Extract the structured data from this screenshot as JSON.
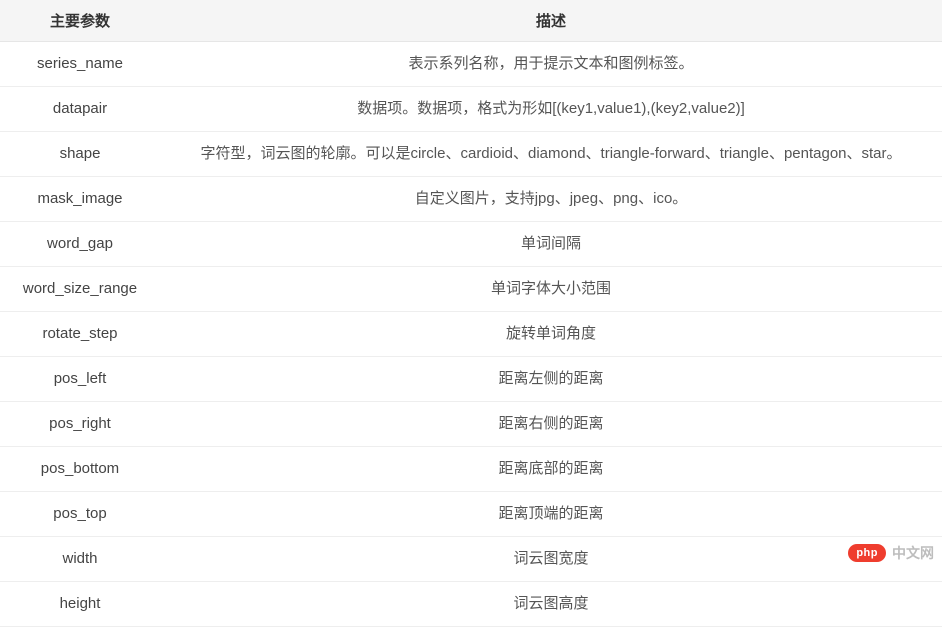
{
  "table": {
    "headers": {
      "param": "主要参数",
      "desc": "描述"
    },
    "rows": [
      {
        "param": "series_name",
        "desc": "表示系列名称，用于提示文本和图例标签。"
      },
      {
        "param": "datapair",
        "desc": "数据项。数据项，格式为形如[(key1,value1),(key2,value2)]"
      },
      {
        "param": "shape",
        "desc": "字符型，词云图的轮廓。可以是circle、cardioid、diamond、triangle-forward、triangle、pentagon、star。"
      },
      {
        "param": "mask_image",
        "desc": "自定义图片，支持jpg、jpeg、png、ico。"
      },
      {
        "param": "word_gap",
        "desc": "单词间隔"
      },
      {
        "param": "word_size_range",
        "desc": "单词字体大小范围"
      },
      {
        "param": "rotate_step",
        "desc": "旋转单词角度"
      },
      {
        "param": "pos_left",
        "desc": "距离左侧的距离"
      },
      {
        "param": "pos_right",
        "desc": "距离右侧的距离"
      },
      {
        "param": "pos_bottom",
        "desc": "距离底部的距离"
      },
      {
        "param": "pos_top",
        "desc": "距离顶端的距离"
      },
      {
        "param": "width",
        "desc": "词云图宽度"
      },
      {
        "param": "height",
        "desc": "词云图高度"
      }
    ]
  },
  "watermark": {
    "badge": "php",
    "text": "中文网"
  }
}
